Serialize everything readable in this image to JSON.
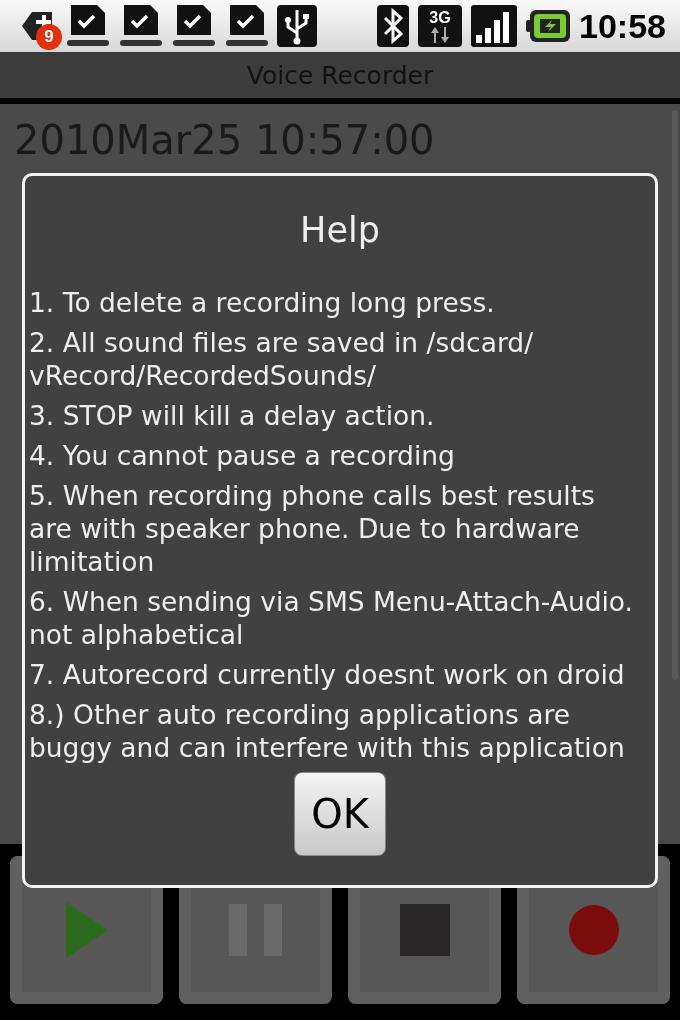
{
  "status_bar": {
    "notification_count": "9",
    "network_type": "3G",
    "time": "10:58"
  },
  "title_bar": {
    "title": "Voice Recorder"
  },
  "recordings": [
    {
      "name": "2010Mar25 10:57:00"
    }
  ],
  "dialog": {
    "title": "Help",
    "lines": [
      "1. To delete a recording long press.",
      "2. All sound files are saved in /sdcard/ vRecord/RecordedSounds/",
      "3. STOP will kill a delay action.",
      "4. You cannot pause a recording",
      "5. When recording phone calls best results are with speaker phone. Due to hardware limitation",
      "6. When sending via SMS Menu-Attach-Audio. not alphabetical",
      "7. Autorecord currently doesnt work on droid",
      "8.) Other auto recording applications are buggy and can interfere with this application"
    ],
    "button": "OK"
  },
  "controls": [
    {
      "kind": "play"
    },
    {
      "kind": "pause"
    },
    {
      "kind": "stop"
    },
    {
      "kind": "record"
    }
  ]
}
